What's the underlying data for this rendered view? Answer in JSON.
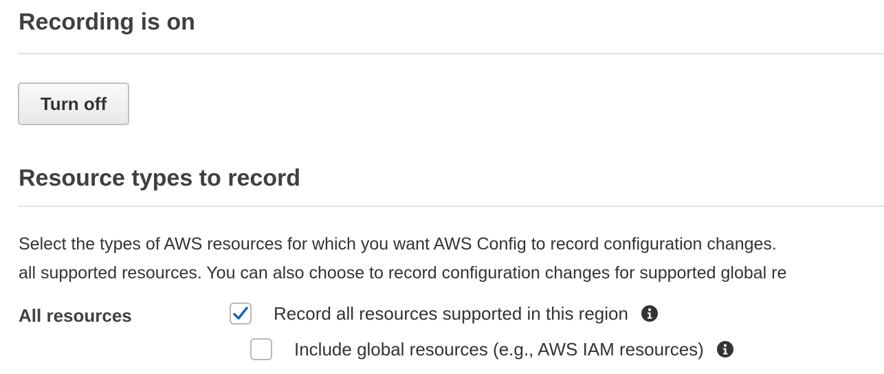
{
  "recording": {
    "title": "Recording is on",
    "turn_off_label": "Turn off"
  },
  "resource_types": {
    "title": "Resource types to record",
    "description_lines": [
      "Select the types of AWS resources for which you want AWS Config to record configuration changes.",
      "all supported resources. You can also choose to record configuration changes for supported global re"
    ],
    "field_label": "All resources",
    "record_all": {
      "label": "Record all resources supported in this region",
      "checked": true,
      "icon": "info-icon"
    },
    "include_global": {
      "label": "Include global resources (e.g., AWS IAM resources)",
      "checked": false,
      "icon": "info-icon"
    }
  },
  "colors": {
    "check_mark": "#1a66b3",
    "text": "#333333",
    "heading": "#404040",
    "divider": "#e1e1e1",
    "info_icon": "#333333"
  }
}
